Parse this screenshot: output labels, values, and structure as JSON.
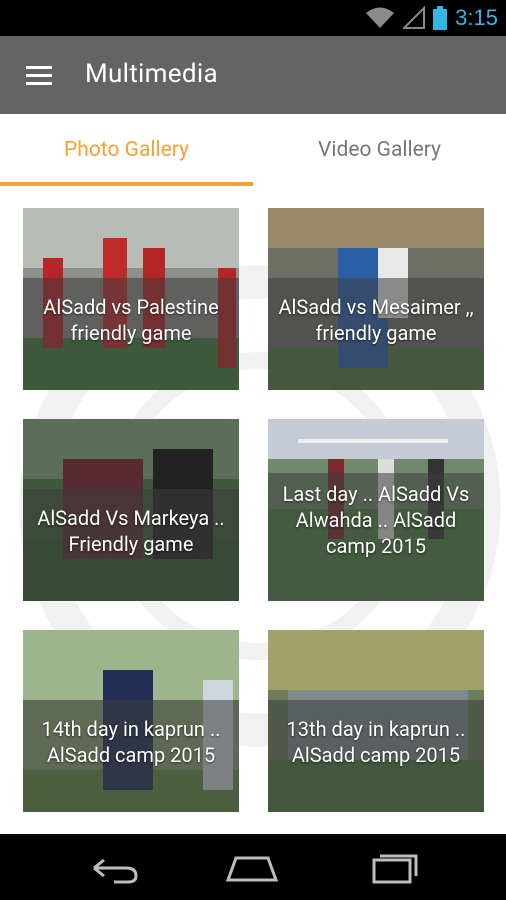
{
  "status_bar": {
    "time": "3:15",
    "icons": [
      "wifi-icon",
      "signal-icon",
      "battery-icon"
    ]
  },
  "app_bar": {
    "title": "Multimedia",
    "menu_icon": "menu-icon"
  },
  "tabs": [
    {
      "label": "Photo Gallery",
      "active": true
    },
    {
      "label": "Video Gallery",
      "active": false
    }
  ],
  "gallery": [
    {
      "caption": "AlSadd vs Palestine friendly game"
    },
    {
      "caption": "AlSadd vs Mesaimer ,, friendly game"
    },
    {
      "caption": "AlSadd Vs Markeya .. Friendly game"
    },
    {
      "caption": "Last day .. AlSadd Vs Alwahda .. AlSadd camp 2015"
    },
    {
      "caption": "14th day in kaprun .. AlSadd camp 2015"
    },
    {
      "caption": "13th day in kaprun .. AlSadd camp 2015"
    }
  ],
  "nav_bar": {
    "buttons": [
      "back-icon",
      "home-icon",
      "recents-icon"
    ]
  },
  "colors": {
    "accent": "#f7a132",
    "app_bar": "#646464",
    "status_time": "#33b5e5"
  }
}
